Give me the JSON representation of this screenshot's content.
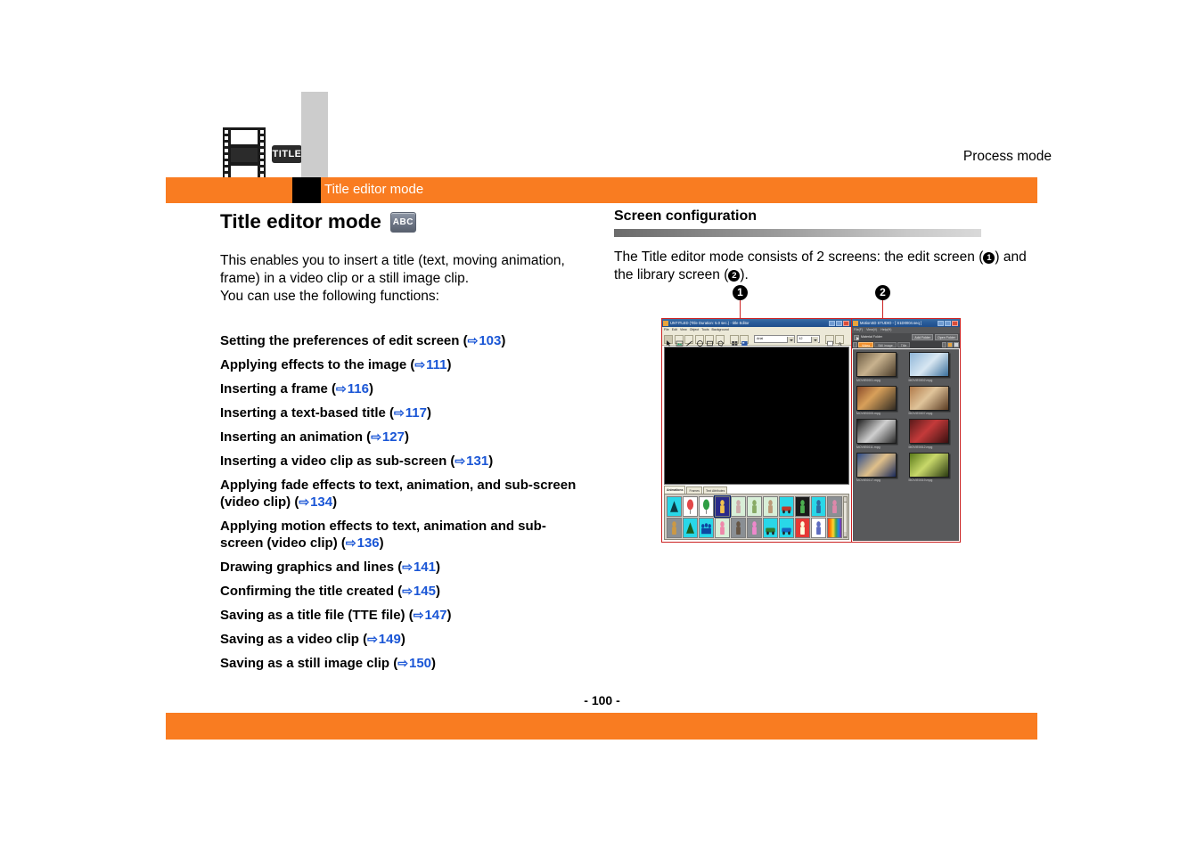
{
  "header": {
    "icon_filmstrip": "filmstrip-icon",
    "icon_title_badge": "TITLE",
    "process_mode": "Process mode",
    "section_label": "Title editor mode",
    "accent_color": "#F97C21"
  },
  "left": {
    "heading": "Title editor mode",
    "heading_badge": "ABC",
    "intro_line1": "This enables you to insert a title (text, moving animation,",
    "intro_line2": "frame) in a video clip or a still image clip.",
    "intro_line3": "You can use the following functions:",
    "functions": [
      {
        "label": "Setting the preferences of edit screen",
        "page": "103"
      },
      {
        "label": "Applying effects to the image",
        "page": "111"
      },
      {
        "label": "Inserting a frame",
        "page": "116"
      },
      {
        "label": "Inserting a text-based title",
        "page": "117"
      },
      {
        "label": "Inserting an animation",
        "page": "127"
      },
      {
        "label": "Inserting a video clip as sub-screen",
        "page": "131"
      },
      {
        "label": "Applying fade effects to text, animation, and sub-screen (video clip)",
        "page": "134"
      },
      {
        "label": "Applying motion effects to text, animation and sub-screen (video clip)",
        "page": "136"
      },
      {
        "label": "Drawing graphics and lines",
        "page": "141"
      },
      {
        "label": "Confirming the title created",
        "page": "145"
      },
      {
        "label": "Saving as a title file (TTE file)",
        "page": "147"
      },
      {
        "label": "Saving as a video clip",
        "page": "149"
      },
      {
        "label": "Saving as a still image clip",
        "page": "150"
      }
    ],
    "arrow_glyph": "⇨",
    "link_color": "#1a56d6"
  },
  "right": {
    "heading": "Screen configuration",
    "para_prefix": "The Title editor mode consists of 2 screens: the edit screen (",
    "para_mid": ") and the library screen (",
    "para_suffix": ").",
    "marker1": "1",
    "marker2": "2",
    "callout1": "1",
    "callout2": "2"
  },
  "screenshot": {
    "edit_window": {
      "title": "UNTITLED (Title Duration: 5.0 sec.) - title Editor",
      "window_buttons": [
        "minimize",
        "maximize",
        "close"
      ],
      "menus": [
        "File",
        "Edit",
        "View",
        "Object",
        "Tools",
        "Background"
      ],
      "toolbar": {
        "font_value": "Arial",
        "size_value": "42",
        "tools": [
          "select-tool",
          "image-tool",
          "line-tool",
          "ellipse-tool",
          "rect-tool",
          "polygon-tool",
          "grid-tool",
          "snap-tool",
          "color-swatch",
          "text-tool"
        ]
      },
      "tabs": [
        "Animations",
        "Frames",
        "Text Attributes"
      ],
      "active_tab": "Animations"
    },
    "library_window": {
      "title": "MotionSD STUDIO - [ S1D0004.seq ]",
      "menus": [
        "File(F)",
        "View(V)",
        "Help(H)"
      ],
      "folder_label": "Material Folder",
      "add_folder": "Add Folder",
      "open_folder": "Open Folder",
      "tabs": [
        "Video",
        "Still image",
        "Title"
      ],
      "active_tab": "Video",
      "thumbnails": [
        "MOVIE0001.mpg",
        "MOVIE0002.mpg",
        "MOVIE0005.mpg",
        "MOVIE0007.mpg",
        "MOVIE0011.mpg",
        "MOVIE0012.mpg",
        "MOVIE0017.mpg",
        "MOVIE0019.mpg"
      ]
    }
  },
  "footer": {
    "page_number": "- 100 -"
  }
}
